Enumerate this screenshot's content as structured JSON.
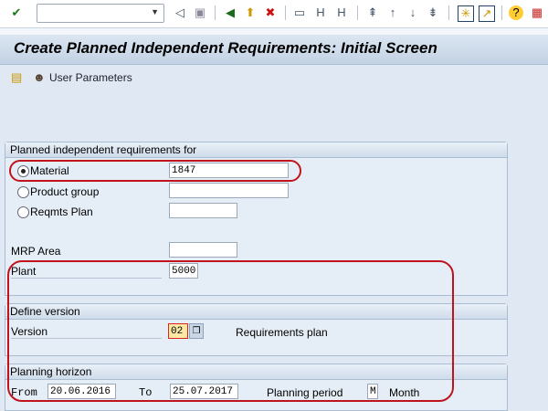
{
  "toolbar": {
    "command_field": "",
    "icons": [
      "enter-icon",
      "back-icon",
      "save-icon",
      "back-green-icon",
      "exit-icon",
      "cancel-icon",
      "print-icon",
      "find-icon",
      "find-next-icon",
      "first-page-icon",
      "previous-page-icon",
      "next-page-icon",
      "last-page-icon",
      "new-session-icon",
      "shortcut-icon",
      "help-icon",
      "layout-icon"
    ]
  },
  "title": "Create Planned Independent Requirements: Initial Screen",
  "app_toolbar": {
    "user_parameters": "User Parameters"
  },
  "group1": {
    "title": "Planned independent requirements for",
    "material_label": "Material",
    "material_value": "1847",
    "product_group_label": "Product group",
    "product_group_value": "",
    "reqmts_plan_label": "Reqmts Plan",
    "reqmts_plan_value": "",
    "mrp_area_label": "MRP Area",
    "mrp_area_value": "",
    "plant_label": "Plant",
    "plant_value": "5000",
    "selected": "Material"
  },
  "group2": {
    "title": "Define version",
    "version_label": "Version",
    "version_value": "02",
    "version_text": "Requirements plan"
  },
  "group3": {
    "title": "Planning horizon",
    "from_label": "From",
    "from_value": "20.06.2016",
    "to_label": "To",
    "to_value": "25.07.2017",
    "period_label": "Planning period",
    "period_value": "M",
    "period_text": "Month"
  },
  "highlight_color": "#c0141c"
}
